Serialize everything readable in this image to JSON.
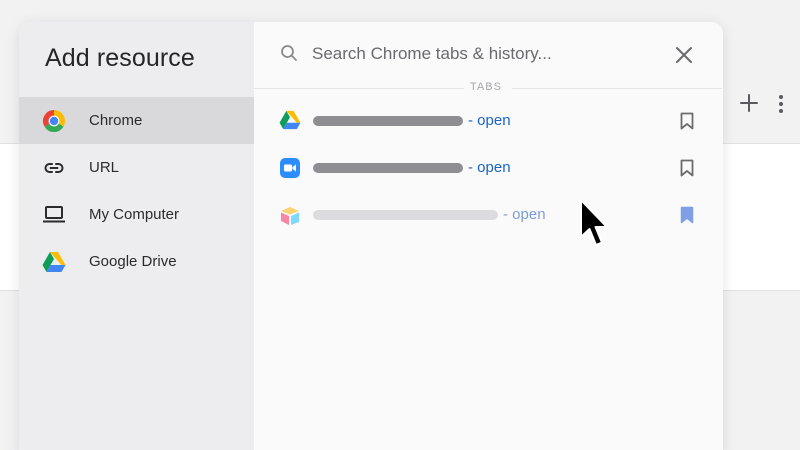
{
  "colors": {
    "accent": "#1a64c8",
    "accent_faded": "#7d9cd8",
    "bookmark_filled": "#7f9ee6"
  },
  "background_toolbar": {
    "add_icon": "plus-icon",
    "more_icon": "more-vertical-icon"
  },
  "sidebar": {
    "title": "Add resource",
    "items": [
      {
        "label": "Chrome",
        "icon": "chrome-icon",
        "active": true
      },
      {
        "label": "URL",
        "icon": "link-icon",
        "active": false
      },
      {
        "label": "My Computer",
        "icon": "laptop-icon",
        "active": false
      },
      {
        "label": "Google Drive",
        "icon": "google-drive-icon",
        "active": false
      }
    ]
  },
  "search": {
    "placeholder": "Search Chrome tabs & history...",
    "value": "",
    "icon": "search-icon",
    "close_icon": "close-icon"
  },
  "section": {
    "label": "TABS"
  },
  "tabs": [
    {
      "favicon": "google-drive-icon",
      "status": "- open",
      "bookmarked": false,
      "faded": false
    },
    {
      "favicon": "zoom-icon",
      "status": "- open",
      "bookmarked": false,
      "faded": false
    },
    {
      "favicon": "airtable-icon",
      "status": "- open",
      "bookmarked": true,
      "faded": true
    }
  ]
}
